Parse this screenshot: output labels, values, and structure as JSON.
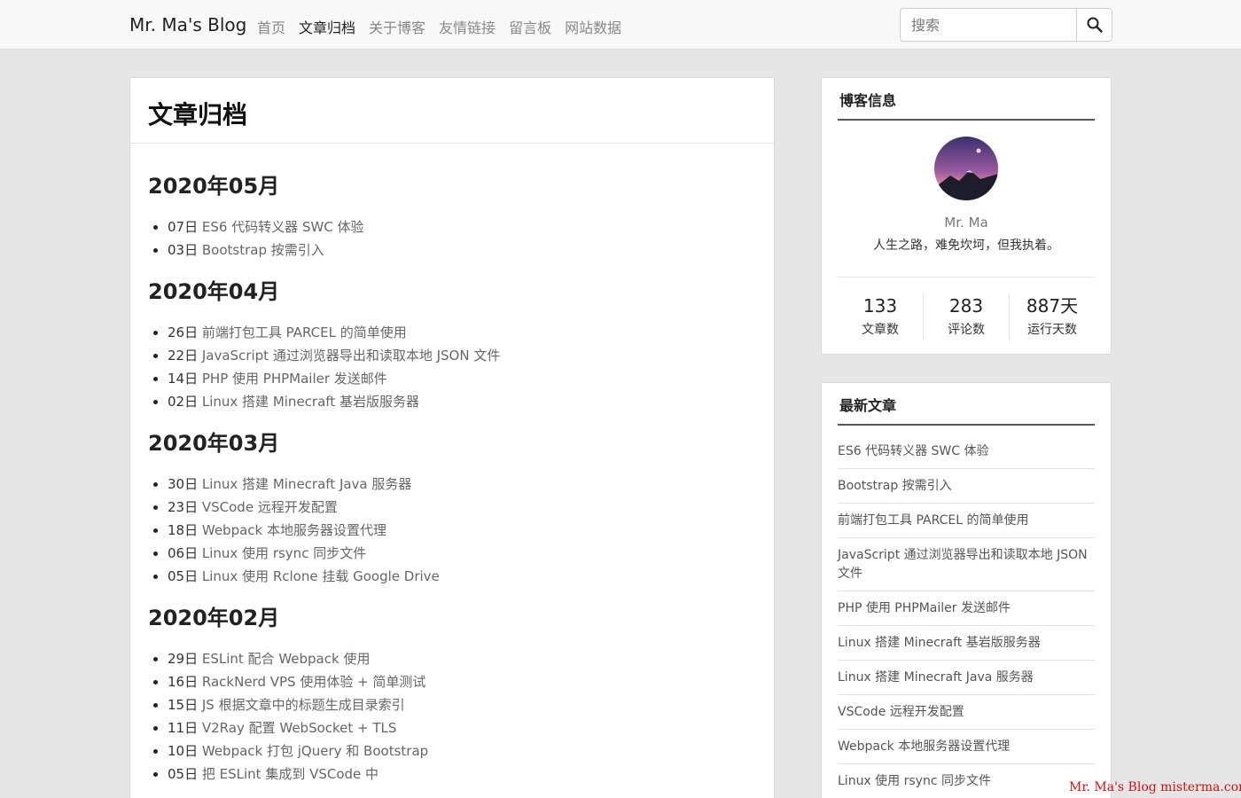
{
  "navbar": {
    "brand": "Mr. Ma's Blog",
    "links": [
      "首页",
      "文章归档",
      "关于博客",
      "友情链接",
      "留言板",
      "网站数据"
    ],
    "active_index": 1,
    "search_placeholder": "搜索"
  },
  "main": {
    "title": "文章归档",
    "months": [
      {
        "title": "2020年05月",
        "posts": [
          {
            "day": "07日",
            "title": "ES6 代码转义器 SWC 体验"
          },
          {
            "day": "03日",
            "title": "Bootstrap 按需引入"
          }
        ]
      },
      {
        "title": "2020年04月",
        "posts": [
          {
            "day": "26日",
            "title": "前端打包工具 PARCEL 的简单使用"
          },
          {
            "day": "22日",
            "title": "JavaScript 通过浏览器导出和读取本地 JSON 文件"
          },
          {
            "day": "14日",
            "title": "PHP 使用 PHPMailer 发送邮件"
          },
          {
            "day": "02日",
            "title": "Linux 搭建 Minecraft 基岩版服务器"
          }
        ]
      },
      {
        "title": "2020年03月",
        "posts": [
          {
            "day": "30日",
            "title": "Linux 搭建 Minecraft Java 服务器"
          },
          {
            "day": "23日",
            "title": "VSCode 远程开发配置"
          },
          {
            "day": "18日",
            "title": "Webpack 本地服务器设置代理"
          },
          {
            "day": "06日",
            "title": "Linux 使用 rsync 同步文件"
          },
          {
            "day": "05日",
            "title": "Linux 使用 Rclone 挂载 Google Drive"
          }
        ]
      },
      {
        "title": "2020年02月",
        "posts": [
          {
            "day": "29日",
            "title": "ESLint 配合 Webpack 使用"
          },
          {
            "day": "16日",
            "title": "RackNerd VPS 使用体验 + 简单测试"
          },
          {
            "day": "15日",
            "title": "JS 根据文章中的标题生成目录索引"
          },
          {
            "day": "11日",
            "title": "V2Ray 配置 WebSocket + TLS"
          },
          {
            "day": "10日",
            "title": "Webpack 打包 jQuery 和 Bootstrap"
          },
          {
            "day": "05日",
            "title": "把 ESLint 集成到 VSCode 中"
          }
        ]
      }
    ]
  },
  "sidebar": {
    "info": {
      "title": "博客信息",
      "author": "Mr. Ma",
      "motto": "人生之路，难免坎坷，但我执着。",
      "stats": [
        {
          "value": "133",
          "label": "文章数"
        },
        {
          "value": "283",
          "label": "评论数"
        },
        {
          "value": "887天",
          "label": "运行天数"
        }
      ]
    },
    "latest": {
      "title": "最新文章",
      "items": [
        "ES6 代码转义器 SWC 体验",
        "Bootstrap 按需引入",
        "前端打包工具 PARCEL 的简单使用",
        "JavaScript 通过浏览器导出和读取本地 JSON 文件",
        "PHP 使用 PHPMailer 发送邮件",
        "Linux 搭建 Minecraft 基岩版服务器",
        "Linux 搭建 Minecraft Java 服务器",
        "VSCode 远程开发配置",
        "Webpack 本地服务器设置代理",
        "Linux 使用 rsync 同步文件"
      ]
    }
  },
  "watermark": "Mr. Ma's Blog  misterma.com",
  "colors": {
    "page_bg": "#e6e6e6",
    "navbar_bg": "#f8f8f8",
    "watermark": "#d01010"
  }
}
